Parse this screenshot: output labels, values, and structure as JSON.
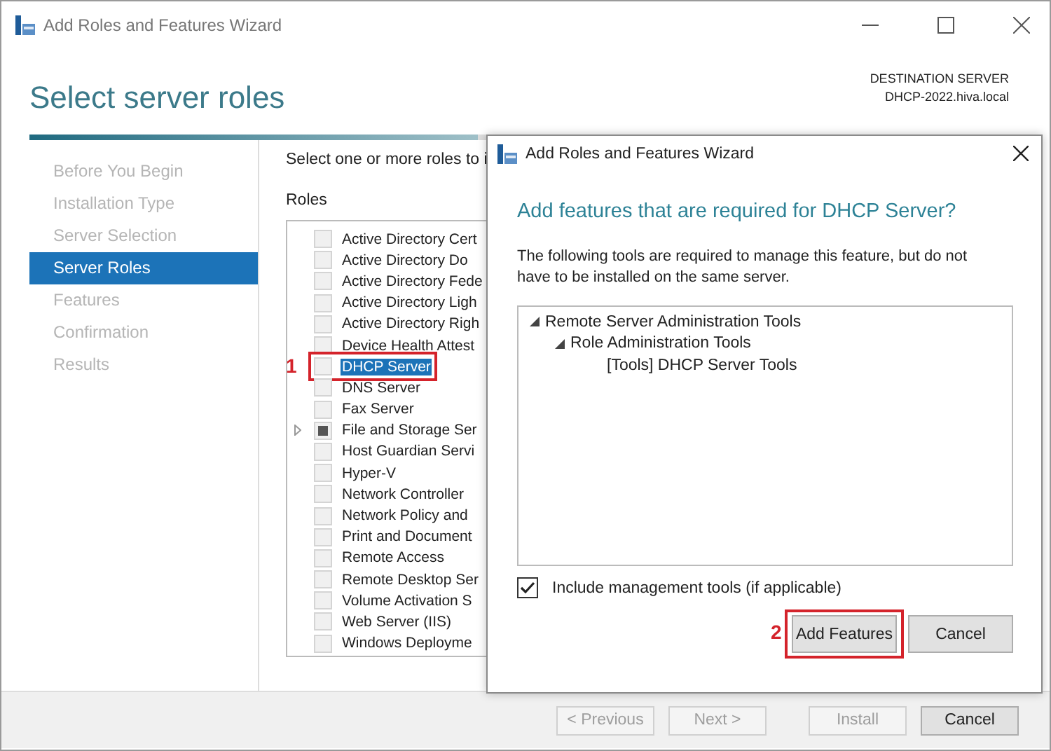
{
  "window": {
    "title": "Add Roles and Features Wizard"
  },
  "header": {
    "title": "Select server roles",
    "destination_label": "DESTINATION SERVER",
    "destination_value": "DHCP-2022.hiva.local"
  },
  "progress": {
    "level": 0.45
  },
  "nav": [
    {
      "label": "Before You Begin",
      "selected": false
    },
    {
      "label": "Installation Type",
      "selected": false
    },
    {
      "label": "Server Selection",
      "selected": false
    },
    {
      "label": "Server Roles",
      "selected": true
    },
    {
      "label": "Features",
      "selected": false
    },
    {
      "label": "Confirmation",
      "selected": false
    },
    {
      "label": "Results",
      "selected": false
    }
  ],
  "instruction": "Select one or more roles to i",
  "roles_label": "Roles",
  "roles": [
    {
      "label": "Active Directory Cert",
      "indeterminate": false,
      "expandable": false,
      "selected": false
    },
    {
      "label": "Active Directory Do",
      "indeterminate": false,
      "expandable": false,
      "selected": false
    },
    {
      "label": "Active Directory Fede",
      "indeterminate": false,
      "expandable": false,
      "selected": false
    },
    {
      "label": "Active Directory Ligh",
      "indeterminate": false,
      "expandable": false,
      "selected": false
    },
    {
      "label": "Active Directory Righ",
      "indeterminate": false,
      "expandable": false,
      "selected": false
    },
    {
      "label": "Device Health Attest",
      "indeterminate": false,
      "expandable": false,
      "selected": false
    },
    {
      "label": "DHCP Server",
      "indeterminate": false,
      "expandable": false,
      "selected": true,
      "callout": "1"
    },
    {
      "label": "DNS Server",
      "indeterminate": false,
      "expandable": false,
      "selected": false
    },
    {
      "label": "Fax Server",
      "indeterminate": false,
      "expandable": false,
      "selected": false
    },
    {
      "label": "File and Storage Ser",
      "indeterminate": true,
      "expandable": true,
      "selected": false
    },
    {
      "label": "Host Guardian Servi",
      "indeterminate": false,
      "expandable": false,
      "selected": false
    },
    {
      "label": "Hyper-V",
      "indeterminate": false,
      "expandable": false,
      "selected": false
    },
    {
      "label": "Network Controller",
      "indeterminate": false,
      "expandable": false,
      "selected": false
    },
    {
      "label": "Network Policy and",
      "indeterminate": false,
      "expandable": false,
      "selected": false
    },
    {
      "label": "Print and Document",
      "indeterminate": false,
      "expandable": false,
      "selected": false
    },
    {
      "label": "Remote Access",
      "indeterminate": false,
      "expandable": false,
      "selected": false
    },
    {
      "label": "Remote Desktop Ser",
      "indeterminate": false,
      "expandable": false,
      "selected": false
    },
    {
      "label": "Volume Activation S",
      "indeterminate": false,
      "expandable": false,
      "selected": false
    },
    {
      "label": "Web Server (IIS)",
      "indeterminate": false,
      "expandable": false,
      "selected": false
    },
    {
      "label": "Windows Deployme",
      "indeterminate": false,
      "expandable": false,
      "selected": false
    }
  ],
  "footer_buttons": [
    {
      "label": "< Previous",
      "disabled": true
    },
    {
      "label": "Next >",
      "disabled": true
    },
    {
      "label": "Install",
      "disabled": true
    },
    {
      "label": "Cancel",
      "disabled": false
    }
  ],
  "dialog": {
    "title": "Add Roles and Features Wizard",
    "heading": "Add features that are required for DHCP Server?",
    "description": "The following tools are required to manage this feature, but do not have to be installed on the same server.",
    "tree": [
      {
        "label": "Remote Server Administration Tools",
        "expanded": true,
        "children": [
          {
            "label": "Role Administration Tools",
            "expanded": true,
            "children": [
              {
                "label": "[Tools] DHCP Server Tools"
              }
            ]
          }
        ]
      }
    ],
    "include_tools": {
      "label": "Include management tools (if applicable)",
      "checked": true
    },
    "buttons": [
      {
        "label": "Add Features",
        "callout": "2"
      },
      {
        "label": "Cancel"
      }
    ]
  }
}
